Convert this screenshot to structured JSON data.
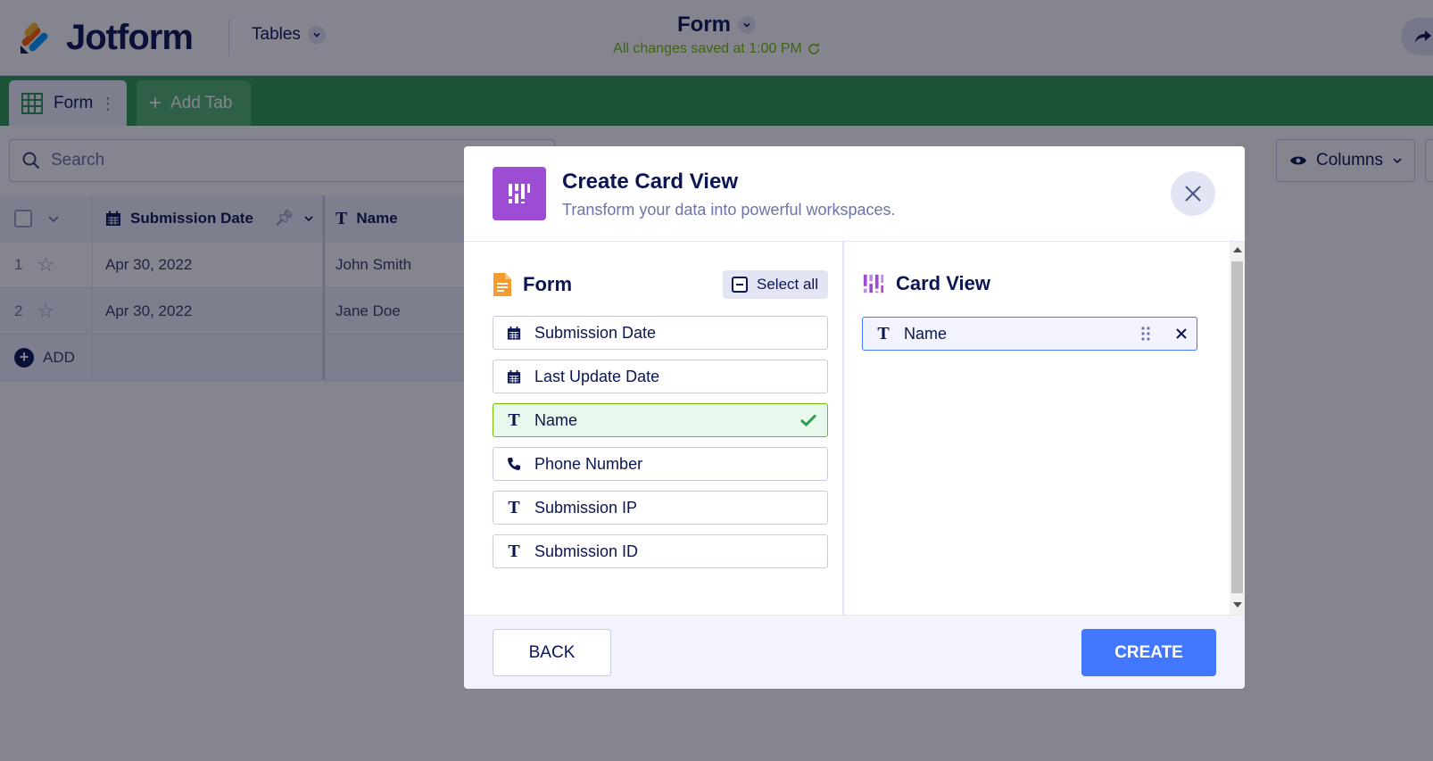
{
  "header": {
    "brand": "Jotform",
    "tables_label": "Tables",
    "title": "Form",
    "saved_status": "All changes saved at 1:00 PM"
  },
  "tabs": [
    {
      "label": "Form"
    },
    {
      "label": "Add Tab"
    }
  ],
  "toolbar": {
    "search_placeholder": "Search",
    "columns_label": "Columns"
  },
  "grid": {
    "headers": [
      "Submission Date",
      "Name"
    ],
    "rows": [
      {
        "num": "1",
        "date": "Apr 30, 2022",
        "name": "John Smith"
      },
      {
        "num": "2",
        "date": "Apr 30, 2022",
        "name": "Jane Doe"
      }
    ],
    "add_label": "ADD"
  },
  "modal": {
    "title": "Create Card View",
    "subtitle": "Transform your data into powerful workspaces.",
    "left_title": "Form",
    "select_all": "Select all",
    "fields": [
      {
        "label": "Submission Date",
        "icon": "calendar-icon",
        "selected": false
      },
      {
        "label": "Last Update Date",
        "icon": "calendar-icon",
        "selected": false
      },
      {
        "label": "Name",
        "icon": "text-icon",
        "selected": true
      },
      {
        "label": "Phone Number",
        "icon": "phone-icon",
        "selected": false
      },
      {
        "label": "Submission IP",
        "icon": "text-icon",
        "selected": false
      },
      {
        "label": "Submission ID",
        "icon": "text-icon",
        "selected": false
      }
    ],
    "right_title": "Card View",
    "card_fields": [
      {
        "label": "Name",
        "icon": "text-icon"
      }
    ],
    "back_label": "BACK",
    "create_label": "CREATE"
  },
  "colors": {
    "accent_blue": "#4277ff",
    "tab_green": "#2e9b53",
    "saved_green": "#78bb07",
    "card_purple": "#9c4dd3",
    "form_orange": "#f79a2e",
    "navy": "#0a1551"
  }
}
